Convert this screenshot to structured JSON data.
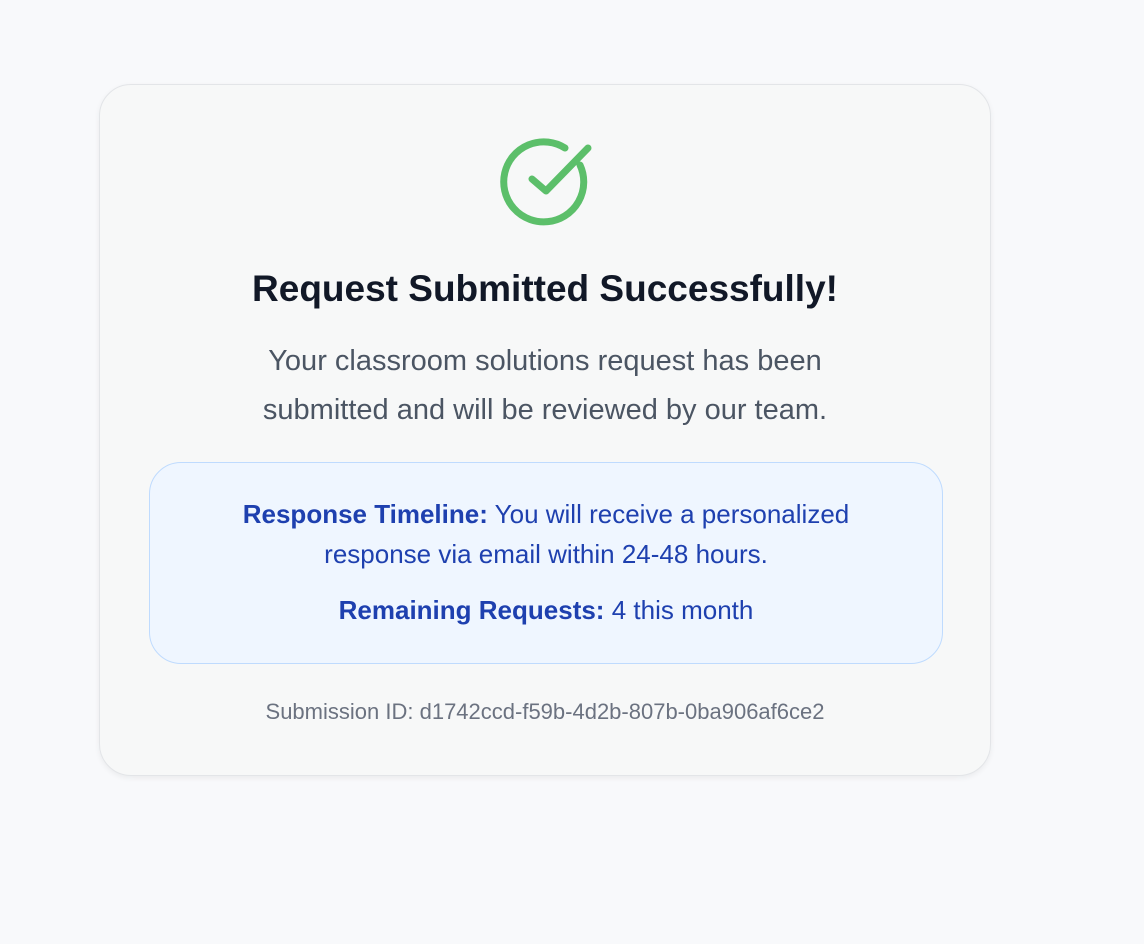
{
  "success": {
    "icon": "check-circle-icon",
    "title": "Request Submitted Successfully!",
    "message_line1": "Your classroom solutions request has been",
    "message_line2": "submitted and will be reviewed by our team."
  },
  "info": {
    "timeline_label": "Response Timeline:",
    "timeline_text_line1": "You will receive a personalized",
    "timeline_text_line2": "response via email within 24-48 hours.",
    "remaining_label": "Remaining Requests:",
    "remaining_value": "4 this month"
  },
  "submission": {
    "label": "Submission ID:",
    "id": "d1742ccd-f59b-4d2b-807b-0ba906af6ce2"
  },
  "colors": {
    "success_green": "#5cbf6a",
    "info_blue_text": "#1e40af",
    "info_bg": "#eff6ff",
    "info_border": "#bfdbfe",
    "title_text": "#111827",
    "body_text": "#4b5563",
    "muted_text": "#6b7280",
    "page_bg": "#f8f9fb"
  }
}
